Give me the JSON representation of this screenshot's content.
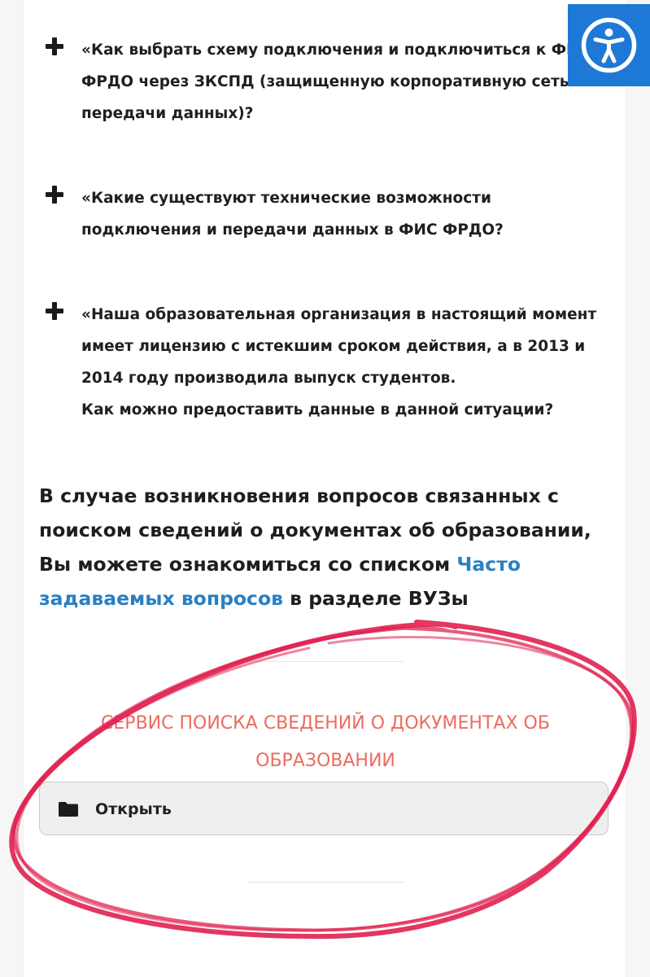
{
  "faq": [
    "«Как выбрать схему подключения и подключиться к ФИС\nФРДО через ЗКСПД (защищенную корпоративную сеть\nпередачи данных)?",
    "«Какие существуют технические возможности\nподключения и передачи данных в ФИС ФРДО?",
    "«Наша образовательная организация в настоящий момент\nимеет лицензию с истекшим сроком действия, а в 2013 и\n2014 году производила выпуск студентов.\nКак можно предоставить данные в данной ситуации?"
  ],
  "notice": {
    "text_before": "В случае возникновения вопросов связанных с поиском сведений о документах об образовании, Вы можете ознакомиться со списком ",
    "link": "Часто задаваемых вопросов",
    "text_after": " в разделе ВУЗы"
  },
  "service": {
    "title": "Сервис поиска сведений о документах об образовании",
    "open_label": "Открыть"
  },
  "icons": {
    "faq_toggle": "plus-icon",
    "open": "folder-icon",
    "accessibility": "accessibility-icon"
  },
  "colors": {
    "link": "#2a7fc1",
    "service_title": "#ec6b5e",
    "accessibility_bg": "#1e78d6",
    "annotation": "#e02050"
  }
}
